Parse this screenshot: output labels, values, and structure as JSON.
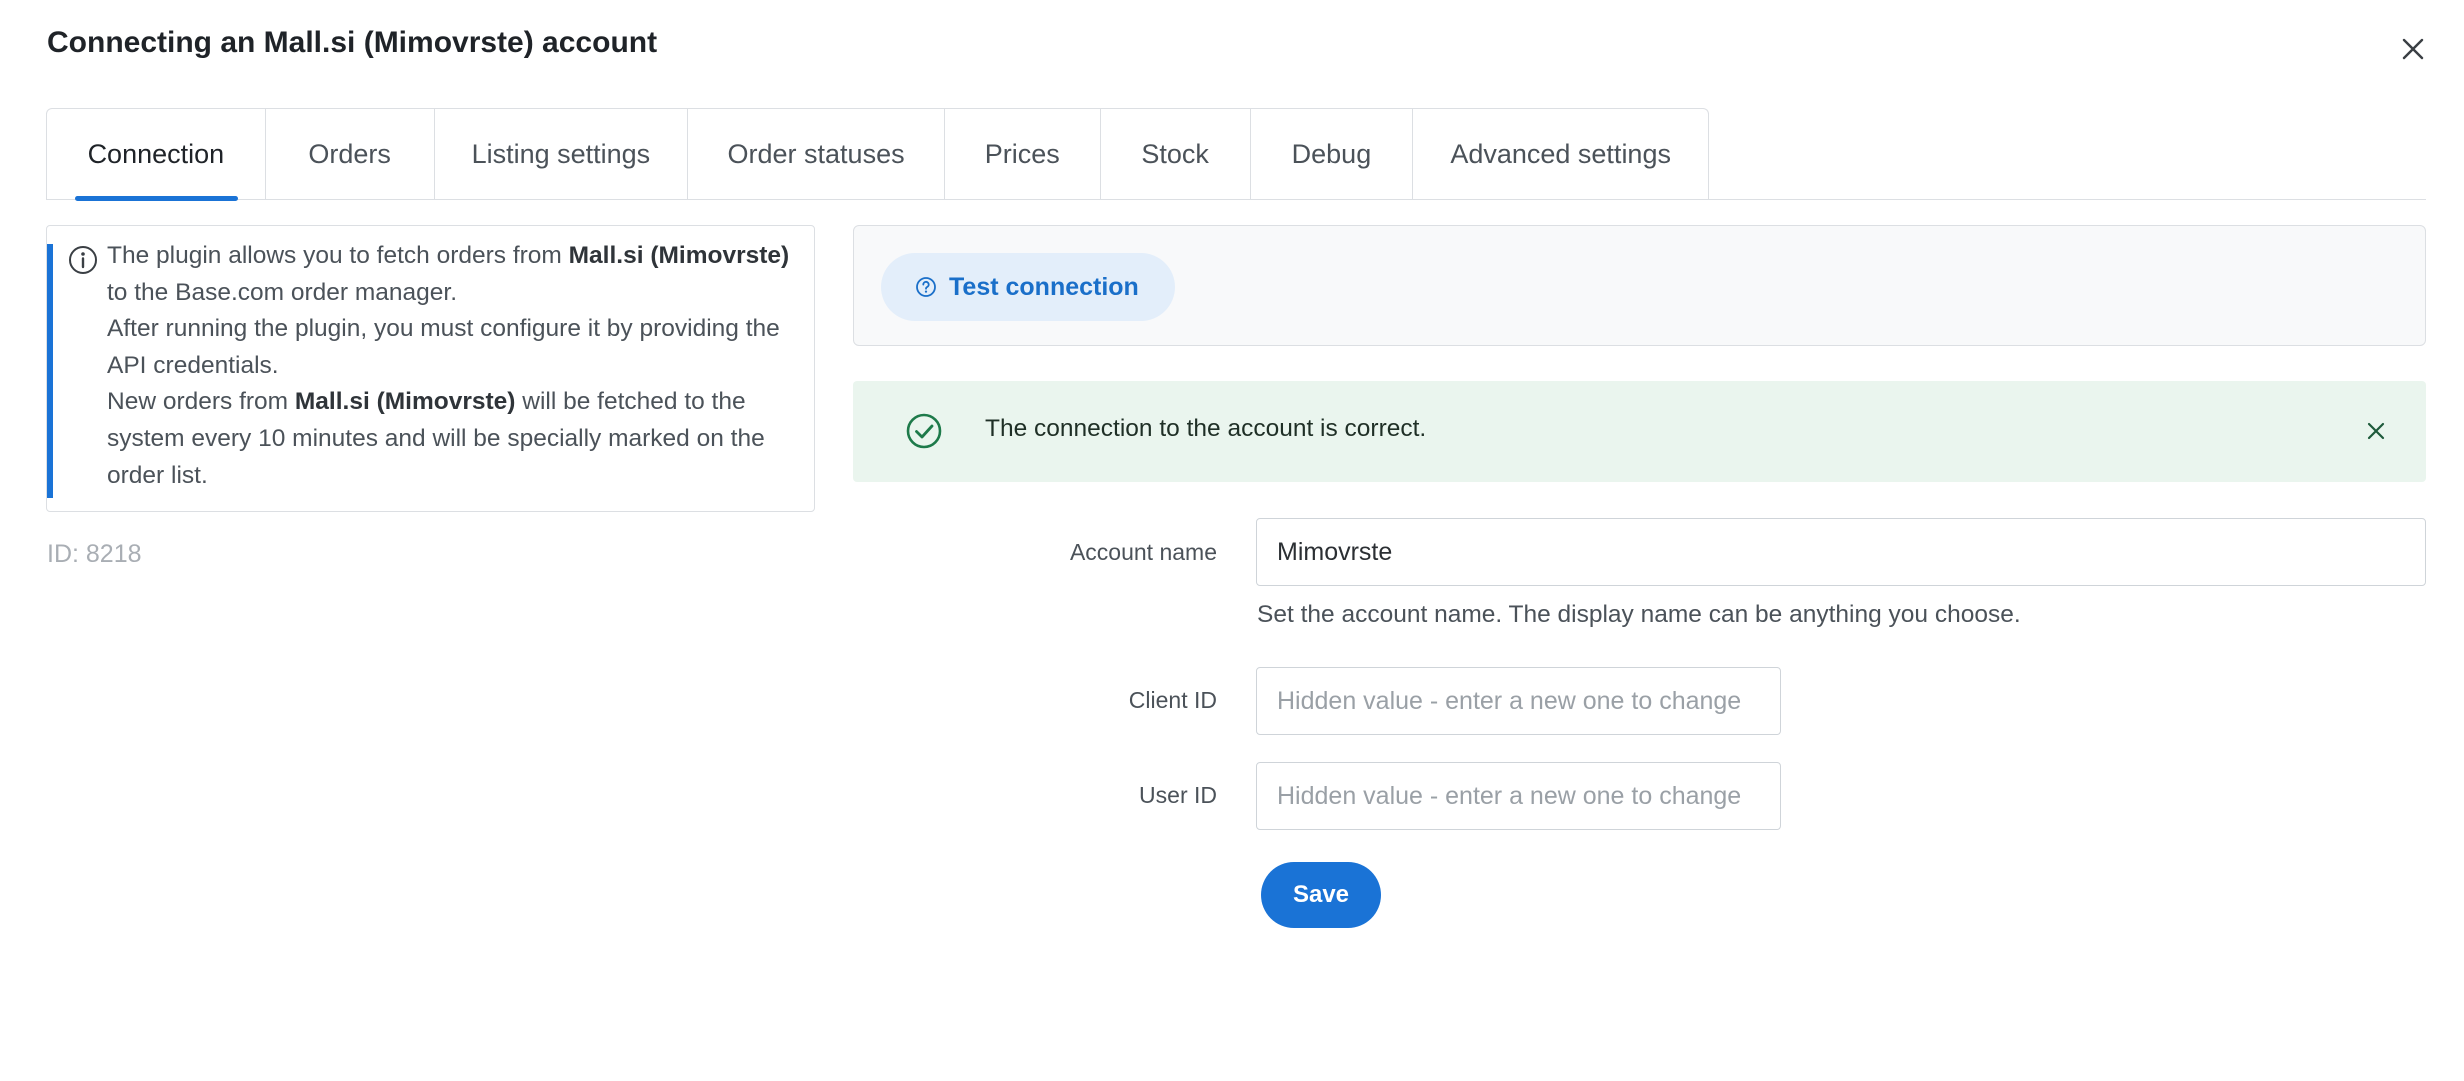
{
  "modal": {
    "title": "Connecting an Mall.si (Mimovrste) account"
  },
  "tabs": [
    {
      "label": "Connection",
      "active": true
    },
    {
      "label": "Orders"
    },
    {
      "label": "Listing settings"
    },
    {
      "label": "Order statuses"
    },
    {
      "label": "Prices"
    },
    {
      "label": "Stock"
    },
    {
      "label": "Debug"
    },
    {
      "label": "Advanced settings"
    }
  ],
  "info": {
    "p1_a": "The plugin allows you to fetch orders from ",
    "p1_bold": "Mall.si (Mimovrste)",
    "p1_b": " to the Base.com order manager.",
    "p2": "After running the plugin, you must configure it by providing the API credentials.",
    "p3_a": "New orders from ",
    "p3_bold": "Mall.si (Mimovrste)",
    "p3_b": " will be fetched to the system every 10 minutes and will be specially marked on the order list."
  },
  "id_label": "ID: 8218",
  "test_connection": {
    "label": "Test connection"
  },
  "alert": {
    "text": "The connection to the account is correct."
  },
  "form": {
    "account_name": {
      "label": "Account name",
      "value": "Mimovrste",
      "help": "Set the account name. The display name can be anything you choose."
    },
    "client_id": {
      "label": "Client ID",
      "placeholder": "Hidden value - enter a new one to change"
    },
    "user_id": {
      "label": "User ID",
      "placeholder": "Hidden value - enter a new one to change"
    },
    "save_label": "Save"
  },
  "colors": {
    "accent": "#1a73d6",
    "success_bg": "#eaf5ee",
    "success_icon": "#1e7a4a"
  }
}
